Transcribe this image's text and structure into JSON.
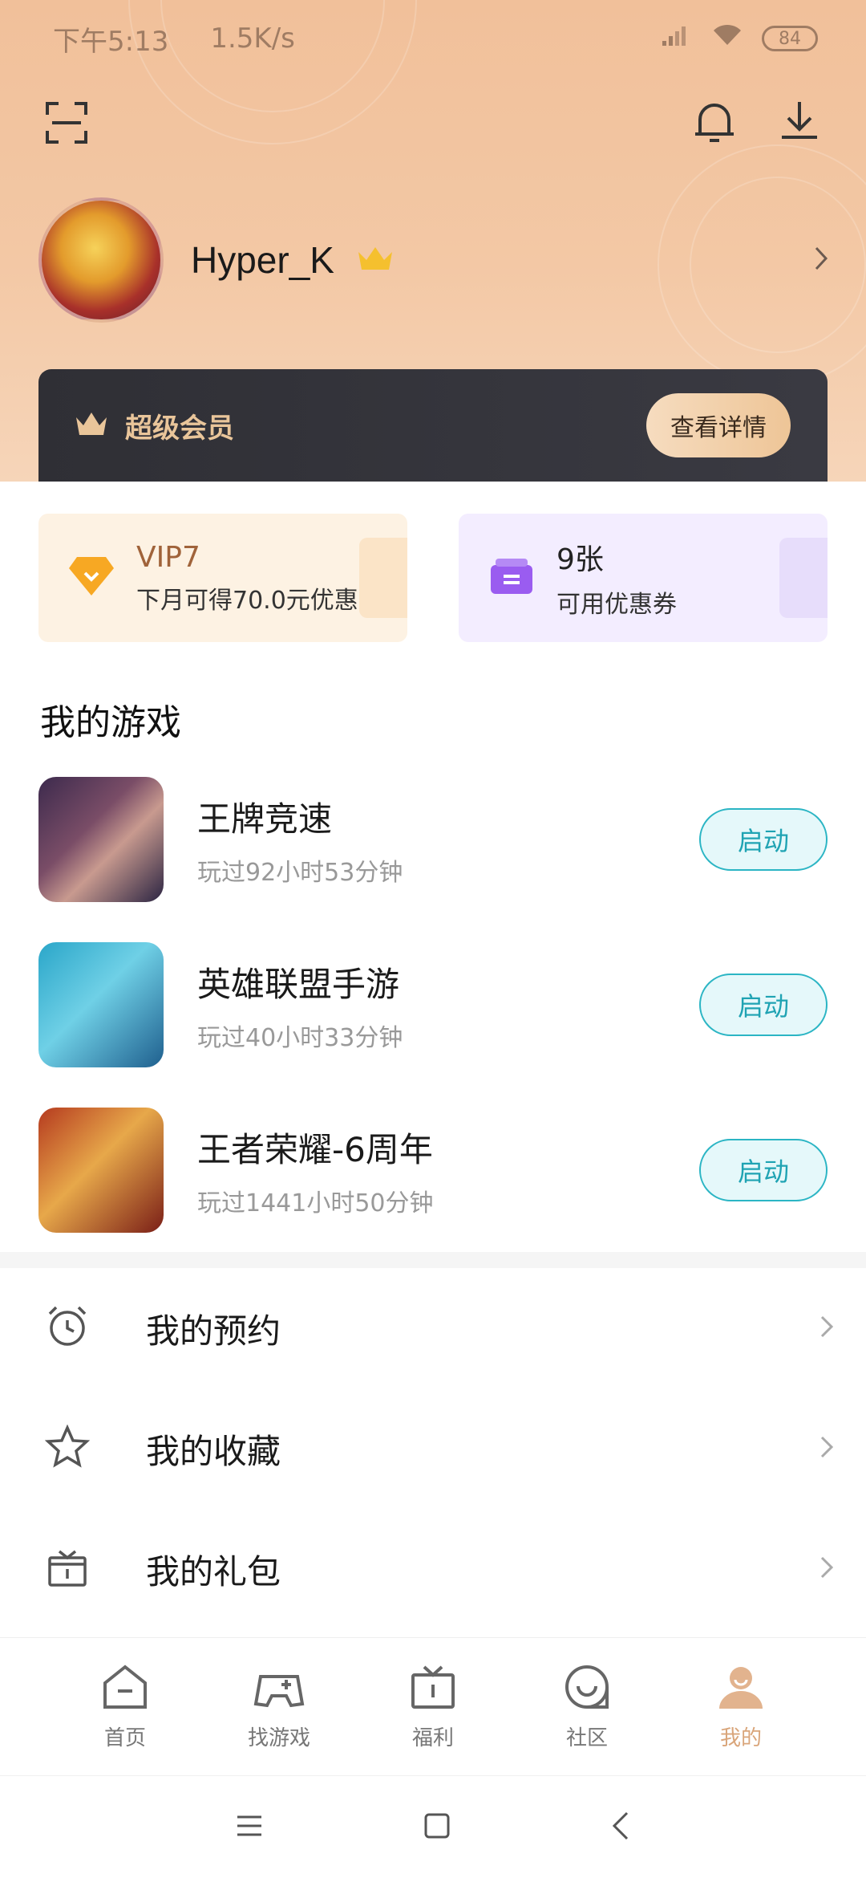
{
  "status_bar": {
    "time": "下午5:13",
    "speed": "1.5K/s",
    "battery": "84"
  },
  "profile": {
    "username": "Hyper_K"
  },
  "vip_banner": {
    "title": "超级会员",
    "details_button": "查看详情"
  },
  "cards": {
    "vip": {
      "level": "VIP7",
      "desc": "下月可得70.0元优惠..."
    },
    "coupon": {
      "count": "9张",
      "desc": "可用优惠券"
    }
  },
  "my_games": {
    "title": "我的游戏",
    "items": [
      {
        "name": "王牌竞速",
        "played": "玩过92小时53分钟",
        "action": "启动"
      },
      {
        "name": "英雄联盟手游",
        "played": "玩过40小时33分钟",
        "action": "启动"
      },
      {
        "name": "王者荣耀-6周年",
        "played": "玩过1441小时50分钟",
        "action": "启动"
      }
    ]
  },
  "menu": [
    {
      "label": "我的预约",
      "icon": "alarm-clock-icon"
    },
    {
      "label": "我的收藏",
      "icon": "star-icon"
    },
    {
      "label": "我的礼包",
      "icon": "gift-icon"
    }
  ],
  "tabs": [
    {
      "label": "首页",
      "icon": "home-icon"
    },
    {
      "label": "找游戏",
      "icon": "gamepad-icon"
    },
    {
      "label": "福利",
      "icon": "gift-icon"
    },
    {
      "label": "社区",
      "icon": "community-icon"
    },
    {
      "label": "我的",
      "icon": "profile-icon",
      "active": true
    }
  ],
  "colors": {
    "accent": "#d9a57a",
    "launch": "#2bb5c4",
    "vip_text": "#e9c59a"
  }
}
